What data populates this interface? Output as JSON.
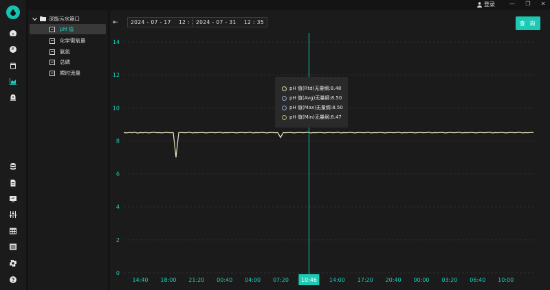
{
  "titlebar": {
    "login_label": "登录",
    "minimize": "—",
    "maximize": "❐",
    "close": "✕"
  },
  "rail": {
    "icons": [
      "dashboard-icon",
      "clock-icon",
      "calendar-icon",
      "area-chart-icon",
      "alarm-icon",
      "database-icon",
      "report-icon",
      "monitor-icon",
      "sliders-icon",
      "table-icon",
      "list-icon",
      "gear-icon",
      "help-icon"
    ],
    "active_icon": "area-chart-icon"
  },
  "tree": {
    "root_label": "深能污水箱口",
    "items": [
      {
        "label": "pH 值",
        "active": true
      },
      {
        "label": "化学需氧量",
        "active": false
      },
      {
        "label": "氨氮",
        "active": false
      },
      {
        "label": "总磷",
        "active": false
      },
      {
        "label": "瞬时流量",
        "active": false
      }
    ]
  },
  "toolbar": {
    "back_icon": "⇤",
    "start_date": "2024 - 07 - 17    12 : 35",
    "end_date": "2024 - 07 - 31    12 : 35",
    "query_label": "查 询"
  },
  "tooltip": {
    "rows": [
      {
        "label": "pH 值(Rtd)无量纲:8.48",
        "color": "#e6dca6"
      },
      {
        "label": "pH 值(Avg)无量纲:8.50",
        "color": "#9aa8c8"
      },
      {
        "label": "pH 值(Max)无量纲:8.50",
        "color": "#9aa8c8"
      },
      {
        "label": "pH 值(Min)无量纲:8.47",
        "color": "#c2b46a"
      }
    ]
  },
  "chart_data": {
    "type": "line",
    "ylim": [
      0,
      14
    ],
    "y_ticks": [
      "0",
      "2",
      "4",
      "6",
      "8",
      "10",
      "12",
      "14"
    ],
    "x_ticks": [
      "14:40",
      "18:00",
      "21:20",
      "00:40",
      "04:00",
      "07:20",
      "10:46",
      "14:00",
      "17:20",
      "20:40",
      "00:00",
      "03:20",
      "06:40",
      "10:00"
    ],
    "highlight_tick": "10:46",
    "grid": true,
    "colors": {
      "line": "#ece6c0",
      "spike": "#c8b25a",
      "cursor": "#1cc9b5"
    },
    "series": [
      {
        "values": [
          8.5,
          8.48,
          8.51,
          8.49,
          8.52,
          8.47,
          8.5,
          8.49,
          8.51,
          8.48,
          8.5,
          8.52,
          8.49,
          8.5,
          8.48,
          8.51,
          8.5,
          8.49,
          8.5,
          7.0,
          8.5,
          8.51,
          8.49,
          8.5,
          8.52,
          8.48,
          8.5,
          8.49,
          8.51,
          8.5,
          8.48,
          8.5,
          8.51,
          8.49,
          8.5,
          8.52,
          8.48,
          8.5,
          8.49,
          8.51,
          8.5,
          8.48,
          8.5,
          8.51,
          8.49,
          8.5,
          8.52,
          8.48,
          8.5,
          8.49,
          8.51,
          8.5,
          8.48,
          8.5,
          8.51,
          8.49,
          8.5,
          8.2,
          8.5,
          8.49,
          8.51,
          8.5,
          8.48,
          8.5,
          8.51,
          8.49,
          8.5,
          8.52,
          8.48,
          8.5,
          8.49,
          8.51,
          8.5,
          8.48,
          8.5,
          8.51,
          8.49,
          8.5,
          8.52,
          8.48,
          8.5,
          8.49,
          8.51,
          8.5,
          8.48,
          8.5,
          8.51,
          8.49,
          8.5,
          8.52,
          8.48,
          8.5,
          8.49,
          8.51,
          8.5,
          8.48,
          8.5,
          8.51,
          8.49,
          8.5,
          8.52,
          8.48,
          8.5,
          8.49,
          8.51,
          8.5,
          8.48,
          8.5,
          8.51,
          8.49,
          8.5,
          8.52,
          8.48,
          8.5,
          8.49,
          8.51,
          8.5,
          8.48,
          8.5,
          8.51,
          8.49,
          8.5,
          8.52,
          8.48,
          8.5,
          8.49,
          8.51,
          8.5,
          8.48,
          8.5,
          8.51,
          8.49,
          8.5,
          8.52,
          8.48,
          8.5,
          8.49,
          8.51,
          8.5,
          8.48,
          8.5,
          8.51,
          8.49,
          8.5,
          8.52,
          8.48,
          8.5,
          8.49,
          8.51,
          8.5
        ]
      }
    ]
  }
}
